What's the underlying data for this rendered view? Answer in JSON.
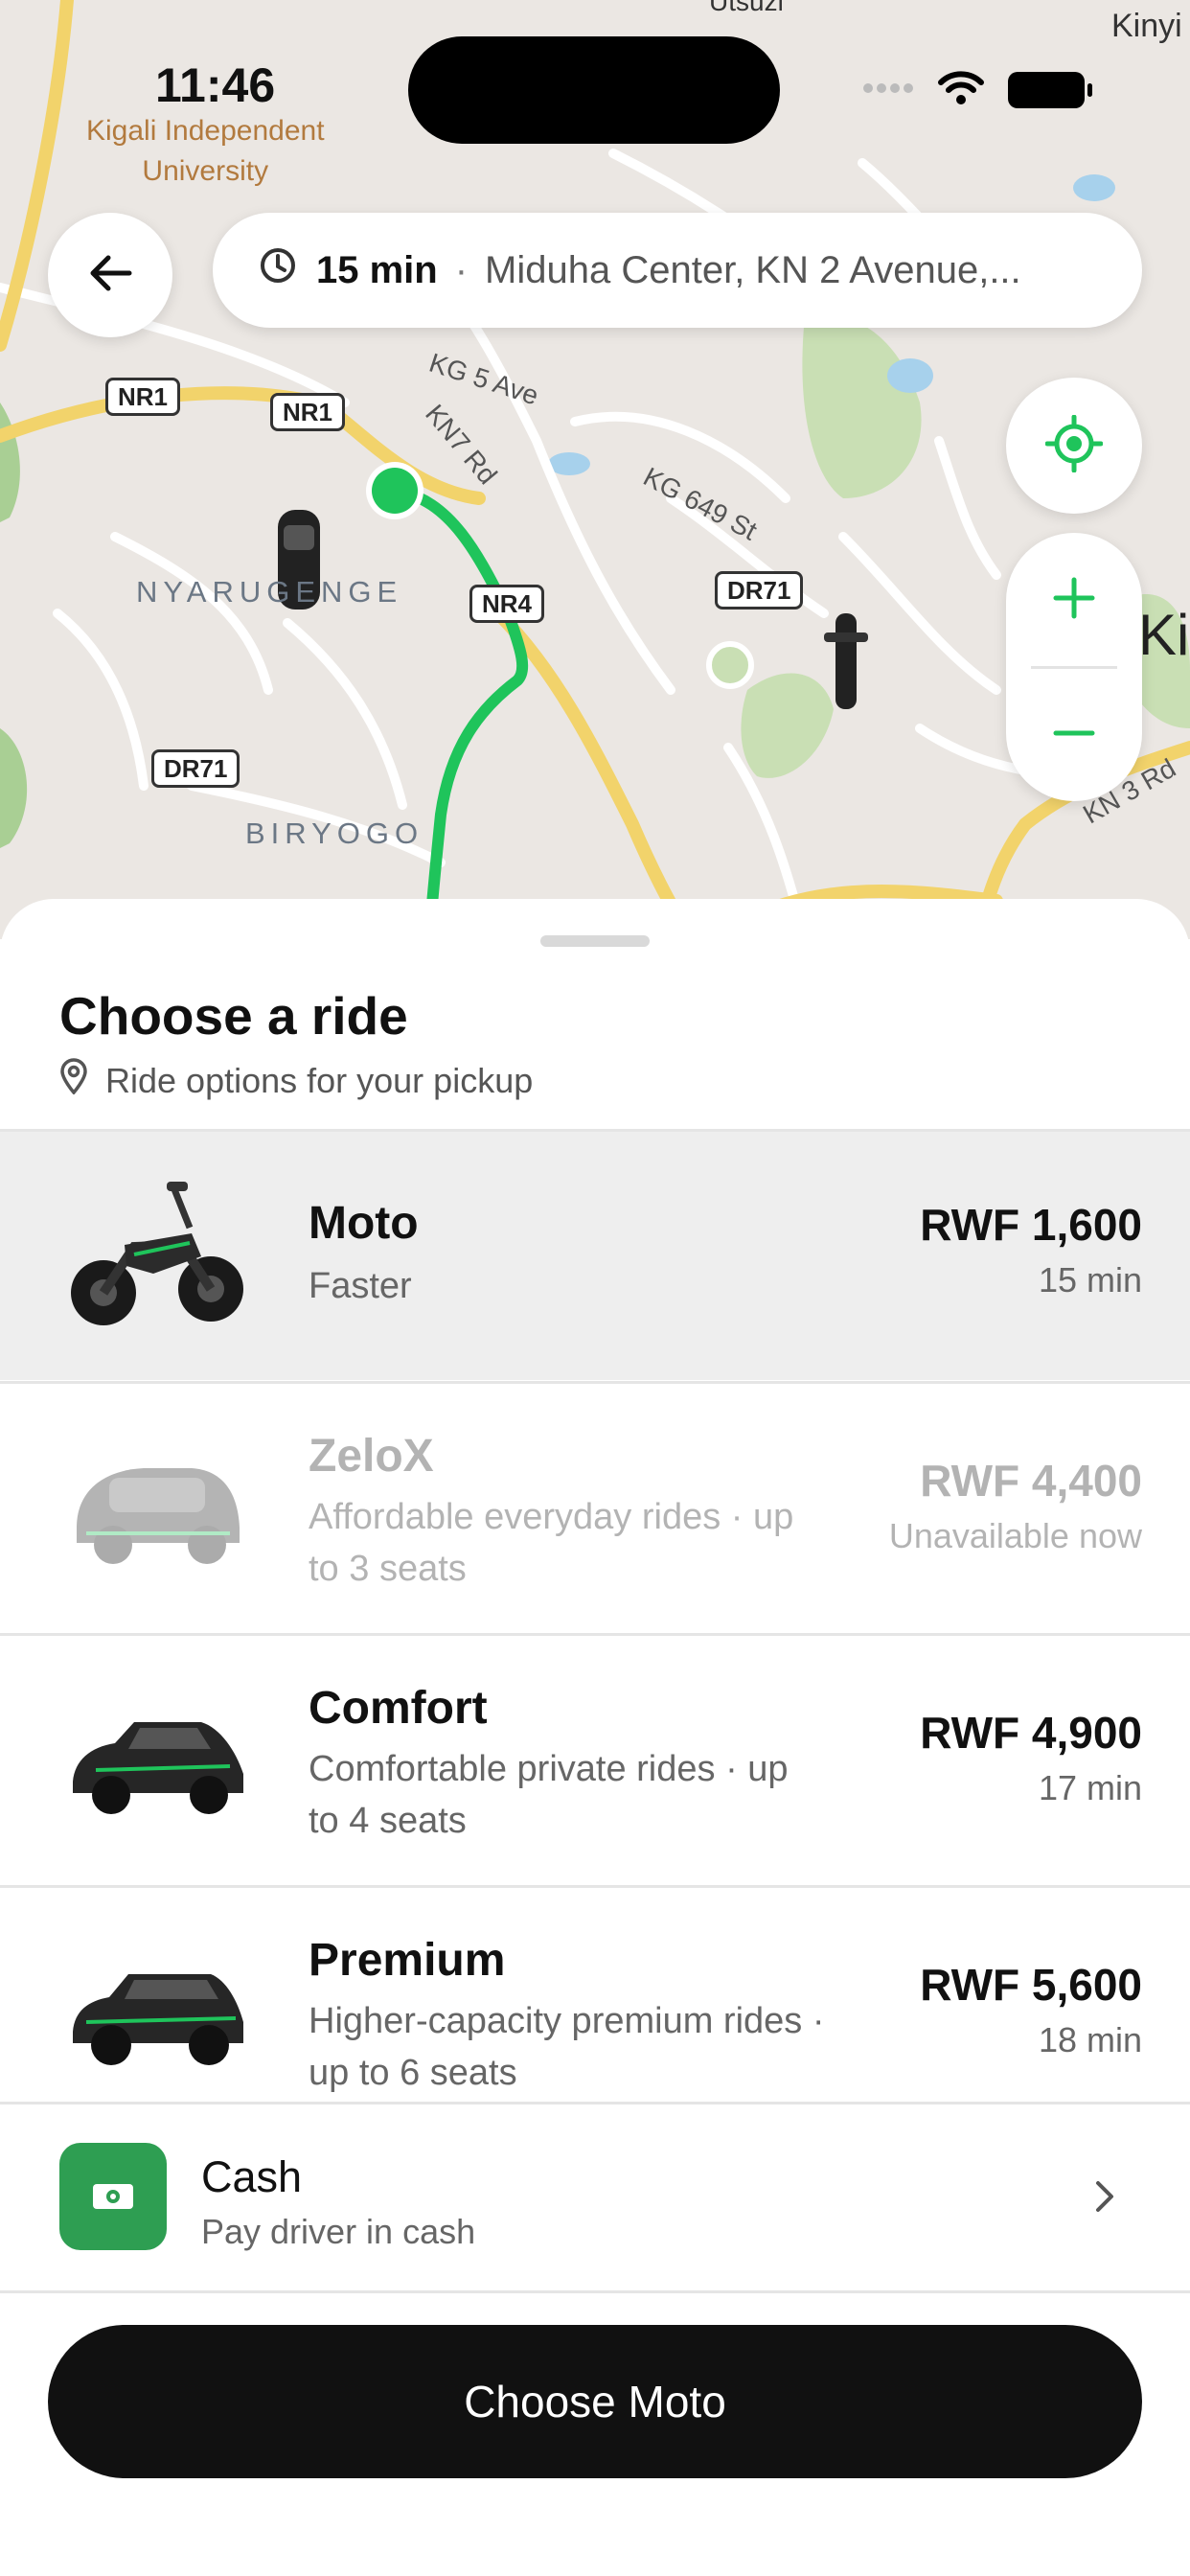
{
  "status_bar": {
    "time": "11:46"
  },
  "map": {
    "poi_label_line1": "Kigali Independent",
    "poi_label_line2": "University",
    "top_clip_label": "Utsuzi",
    "right_top_clip": "Kinyi",
    "area_labels": [
      "NYARUGENGE",
      "BIRYOGO"
    ],
    "right_edge_label": "Ki",
    "street_labels": [
      "KG 5 Ave",
      "KN7 Rd",
      "KG 649 St",
      "KN 3 Rd"
    ],
    "road_shields": [
      "NR1",
      "NR1",
      "DR71",
      "DR71",
      "NR4"
    ],
    "route_color": "#1fc45b",
    "highway_color": "#f2d36b"
  },
  "trip": {
    "eta": "15 min",
    "separator": "·",
    "destination": "Miduha Center, KN 2 Avenue,..."
  },
  "sheet": {
    "title": "Choose a ride",
    "subtitle": "Ride options for your pickup"
  },
  "rides": [
    {
      "name": "Moto",
      "desc": "Faster",
      "price": "RWF 1,600",
      "time": "15 min",
      "icon": "motorcycle-icon"
    },
    {
      "name": "ZeloX",
      "desc": "Affordable everyday rides · up to 3 seats",
      "price": "RWF 4,400",
      "time": "Unavailable now",
      "icon": "small-car-icon"
    },
    {
      "name": "Comfort",
      "desc": "Comfortable private rides · up to 4 seats",
      "price": "RWF 4,900",
      "time": "17 min",
      "icon": "hatchback-icon"
    },
    {
      "name": "Premium",
      "desc": "Higher-capacity premium rides · up to 6 seats",
      "price": "RWF 5,600",
      "time": "18 min",
      "icon": "suv-icon"
    }
  ],
  "payment": {
    "title": "Cash",
    "subtitle": "Pay driver in cash",
    "accent": "#2e9e52"
  },
  "cta": {
    "label": "Choose Moto"
  }
}
